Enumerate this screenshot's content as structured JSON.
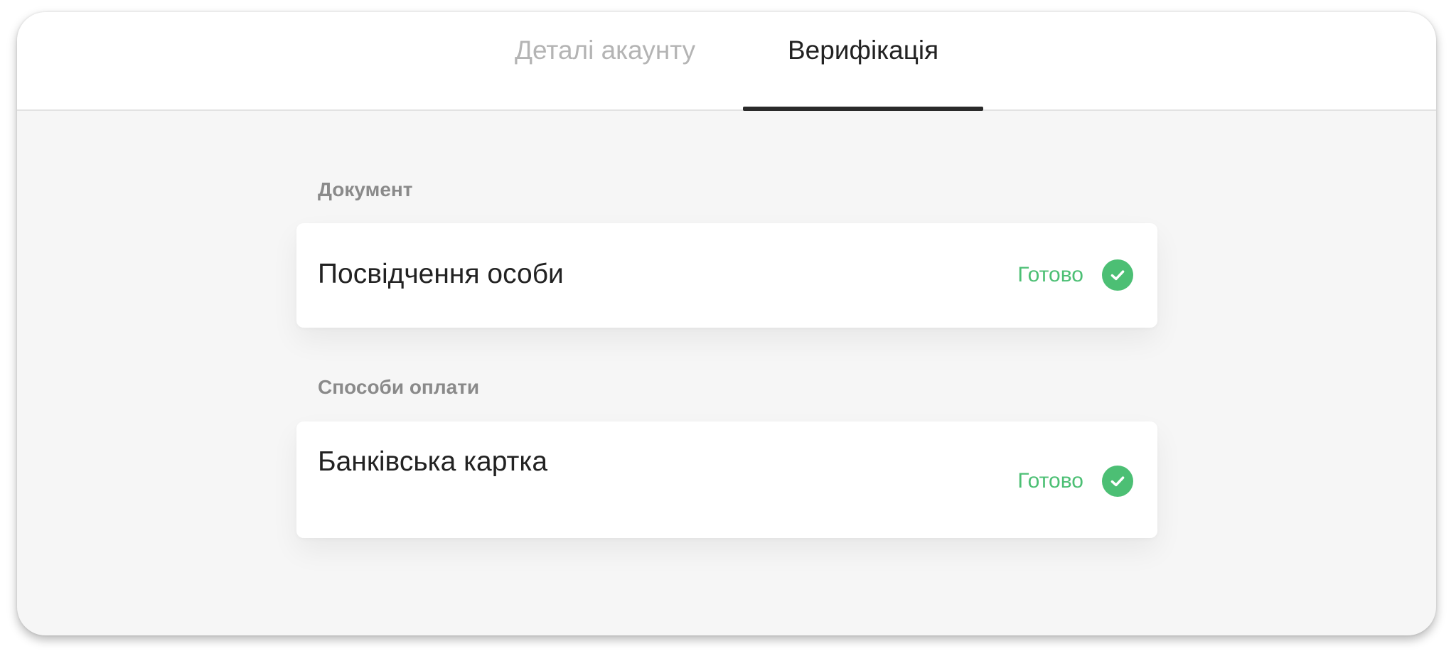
{
  "tabs": {
    "account_details": "Деталі акаунту",
    "verification": "Верифікація",
    "active": "verification"
  },
  "sections": [
    {
      "title": "Документ",
      "item_label": "Посвідчення особи",
      "status": "Готово"
    },
    {
      "title": "Способи оплати",
      "item_label": "Банківська картка",
      "status": "Готово"
    }
  ],
  "colors": {
    "status_success": "#4cbf74",
    "tab_inactive": "#b4b4b4",
    "tab_active": "#222222"
  },
  "icons": {
    "status": "check-circle-icon"
  }
}
